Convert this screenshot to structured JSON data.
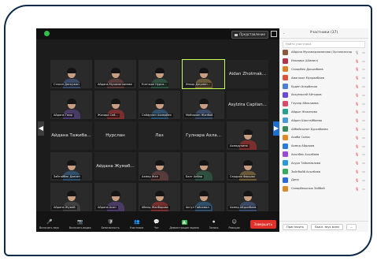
{
  "topbar": {
    "view_label": "Представление"
  },
  "tiles": [
    {
      "label": "Стасон Доскужан",
      "center": "",
      "video": true
    },
    {
      "label": "Айдана Мухаматханова",
      "center": "",
      "video": true
    },
    {
      "label": "Есенжан Нурса...",
      "center": "",
      "video": true
    },
    {
      "label": "Инкар Джуман...",
      "center": "",
      "video": true,
      "active": true
    },
    {
      "label": "",
      "center": "Aidan Zhotmak...",
      "video": false
    },
    {
      "label": "Айдана Тюхр",
      "center": "",
      "video": true
    },
    {
      "label": "Жазира Сей...",
      "center": "",
      "video": true
    },
    {
      "label": "Сейфулин Ахмедбек",
      "center": "",
      "video": true
    },
    {
      "label": "Мейирхан Жанбай",
      "center": "",
      "video": true
    },
    {
      "label": "",
      "center": "Аsylzira Capilan...",
      "video": false
    },
    {
      "label": "",
      "center": "Айдана Тажиба...",
      "video": false
    },
    {
      "label": "",
      "center": "Нурслан",
      "video": false
    },
    {
      "label": "",
      "center": "Лаз",
      "video": false
    },
    {
      "label": "",
      "center": "Гулнара Ахла...",
      "video": false
    },
    {
      "label": "Ахмадулина",
      "center": "",
      "video": true
    },
    {
      "label": "Зайтайбек Давлет",
      "center": "",
      "video": true
    },
    {
      "label": "",
      "center": "Айдана Жумаб...",
      "video": false
    },
    {
      "label": "Ахмед Жан",
      "center": "",
      "video": true
    },
    {
      "label": "Балт Акбар",
      "center": "",
      "video": true
    },
    {
      "label": "Сердрип Фаршах",
      "center": "",
      "video": true
    },
    {
      "label": "Айдана Жумаб",
      "center": "",
      "video": true
    },
    {
      "label": "Айдана Асан",
      "center": "",
      "video": true
    },
    {
      "label": "Абилд Жанбарова",
      "center": "",
      "video": true
    },
    {
      "label": "Акгул Тайкемал",
      "center": "",
      "video": true
    },
    {
      "label": "Ахмед Айдынбаев",
      "center": "",
      "video": true
    }
  ],
  "toolbar": {
    "items": [
      {
        "label": "Включить звук",
        "icon": "🎤"
      },
      {
        "label": "Включить видео",
        "icon": "📷"
      },
      {
        "label": "Безопасность",
        "icon": "🛡"
      },
      {
        "label": "Участники",
        "icon": "👥"
      },
      {
        "label": "Чат",
        "icon": "💬"
      },
      {
        "label": "Демонстрация экрана",
        "icon": "▲"
      },
      {
        "label": "Запись",
        "icon": "⏺"
      },
      {
        "label": "Реакции",
        "icon": "☺"
      }
    ],
    "end_label": "Завершить"
  },
  "panel": {
    "title": "Участники (37)",
    "search_placeholder": "Найти участника",
    "participants": [
      {
        "name": "Айдана Мухамедзаманова (Организатор, я)",
        "color": "#8a5a3c",
        "muted": false
      },
      {
        "name": "Ильмира (Шамил)",
        "color": "#b0374b",
        "muted": true
      },
      {
        "name": "Сапарбек Досымбаев",
        "color": "#d9822b",
        "muted": true
      },
      {
        "name": "Аманжол Мухрамбаев",
        "color": "#d9533a",
        "muted": true
      },
      {
        "name": "Ерден Анарбеков",
        "color": "#4a7fd6",
        "muted": true
      },
      {
        "name": "Аккумысай Айтыров",
        "color": "#6a4ad6",
        "muted": true
      },
      {
        "name": "Гаухар Аблалиева",
        "color": "#d94a6a",
        "muted": true
      },
      {
        "name": "Айдын Жакенова",
        "color": "#2aa08c",
        "muted": true
      },
      {
        "name": "Айдан Шалтайбаева",
        "color": "#4a9ad6",
        "muted": true
      },
      {
        "name": "Айбайкынан Бурхабаева",
        "color": "#3a8a5c",
        "muted": true
      },
      {
        "name": "Ахиба Сыпас",
        "color": "#e08a2a",
        "muted": true
      },
      {
        "name": "Ахмед Айдаров",
        "color": "#2a7ad6",
        "muted": true
      },
      {
        "name": "Асылбек Асызбаев",
        "color": "#9a4ad6",
        "muted": true
      },
      {
        "name": "Асура Тайкемалова",
        "color": "#2a9ad6",
        "muted": true
      },
      {
        "name": "Зайтбайб Асызбаев",
        "color": "#3aaa5c",
        "muted": true
      },
      {
        "name": "Дина",
        "color": "#2a6ad6",
        "muted": true
      },
      {
        "name": "Сапарбекызык Зейбей",
        "color": "#d98a2a",
        "muted": true
      }
    ],
    "invite_label": "Пригласить",
    "mute_all_label": "Выкл. звук всем"
  }
}
